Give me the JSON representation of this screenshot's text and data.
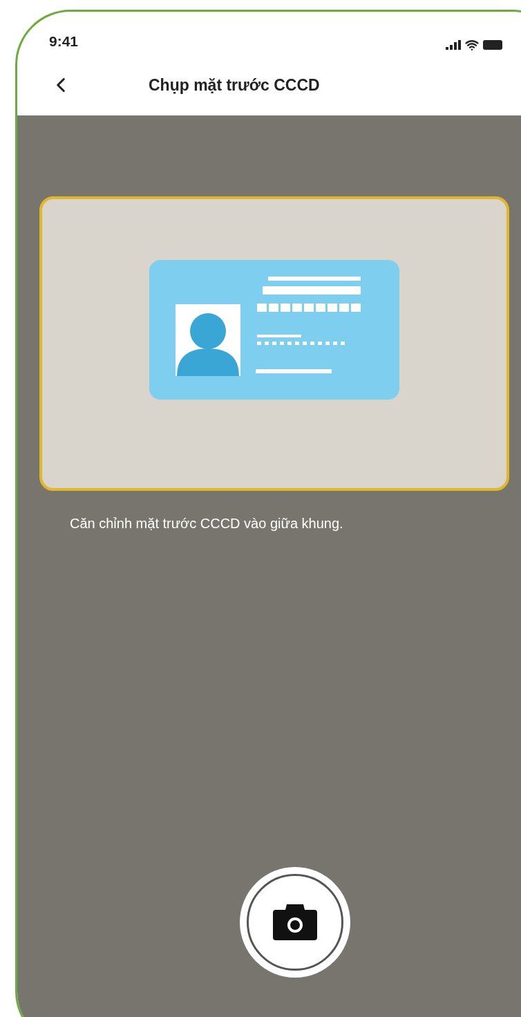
{
  "status_bar": {
    "time": "9:41"
  },
  "nav_bar": {
    "title": "Chụp mặt trước CCCD"
  },
  "camera": {
    "instruction": "Căn chỉnh mặt trước CCCD vào giữa khung."
  }
}
